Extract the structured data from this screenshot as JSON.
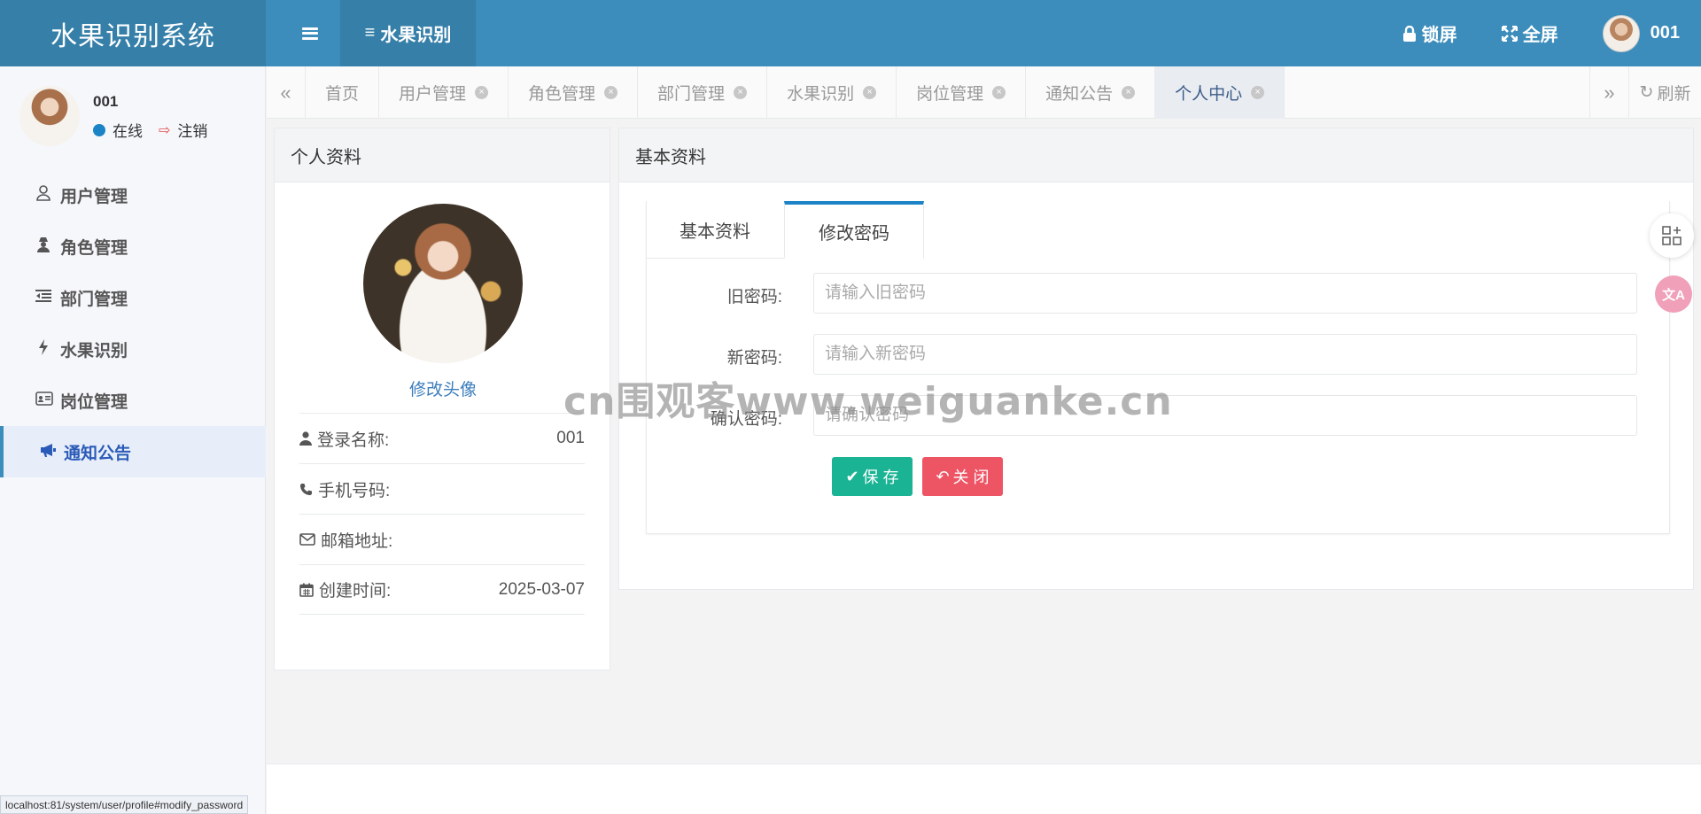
{
  "app": {
    "title": "水果识别系统"
  },
  "topbar": {
    "active_label": "水果识别",
    "lock_label": "锁屏",
    "fullscreen_label": "全屏",
    "user_name": "001"
  },
  "sidebar": {
    "user_name": "001",
    "status_label": "在线",
    "logout_label": "注销",
    "items": [
      {
        "label": "用户管理",
        "icon": "user-icon"
      },
      {
        "label": "角色管理",
        "icon": "user-secret-icon"
      },
      {
        "label": "部门管理",
        "icon": "outdent-icon"
      },
      {
        "label": "水果识别",
        "icon": "bolt-icon"
      },
      {
        "label": "岗位管理",
        "icon": "id-card-icon"
      },
      {
        "label": "通知公告",
        "icon": "bullhorn-icon"
      }
    ]
  },
  "tabs": {
    "items": [
      {
        "label": "首页"
      },
      {
        "label": "用户管理"
      },
      {
        "label": "角色管理"
      },
      {
        "label": "部门管理"
      },
      {
        "label": "水果识别"
      },
      {
        "label": "岗位管理"
      },
      {
        "label": "通知公告"
      },
      {
        "label": "个人中心"
      }
    ],
    "refresh_label": "刷新"
  },
  "profile": {
    "title": "个人资料",
    "change_avatar": "修改头像",
    "rows": [
      {
        "label": "登录名称:",
        "value": "001"
      },
      {
        "label": "手机号码:",
        "value": ""
      },
      {
        "label": "邮箱地址:",
        "value": ""
      },
      {
        "label": "创建时间:",
        "value": "2025-03-07"
      }
    ]
  },
  "basic": {
    "title": "基本资料",
    "tabs": [
      "基本资料",
      "修改密码"
    ],
    "fields": [
      {
        "label": "旧密码:",
        "placeholder": "请输入旧密码"
      },
      {
        "label": "新密码:",
        "placeholder": "请输入新密码"
      },
      {
        "label": "确认密码:",
        "placeholder": "请确认密码"
      }
    ],
    "save_label": "保 存",
    "close_label": "关 闭"
  },
  "watermark": "cn围观客www.weiguanke.cn",
  "status_url": "localhost:81/system/user/profile#modify_password",
  "colors": {
    "header": "#3c8dbc",
    "header_dark": "#367fa9",
    "save": "#1ab394",
    "close": "#ed5565",
    "active_menu": "#2b5bb8"
  }
}
